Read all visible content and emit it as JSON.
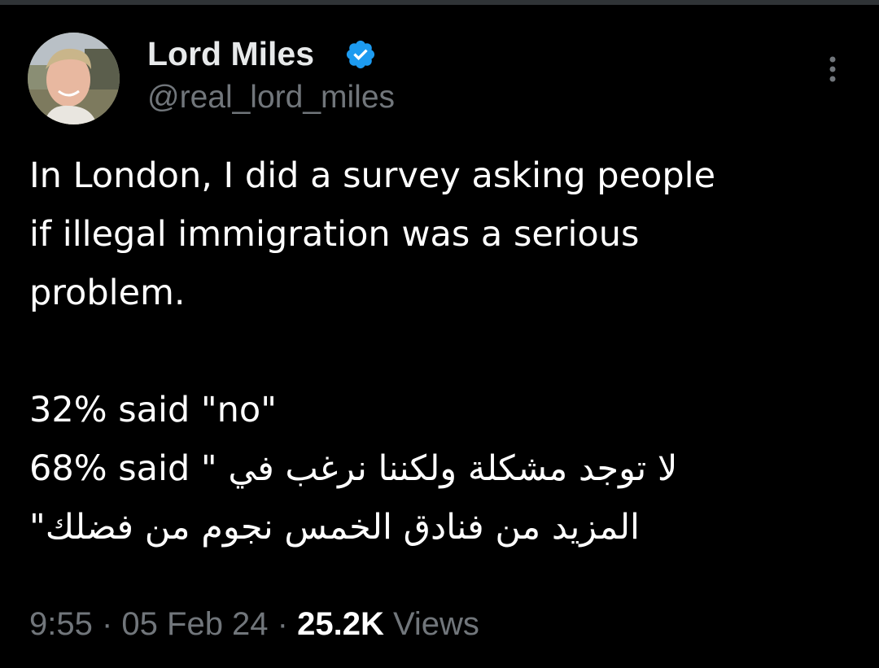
{
  "colors": {
    "background": "#000000",
    "text_primary": "#ffffff",
    "text_secondary": "#71767b",
    "verified_badge": "#1d9bf0",
    "divider": "#2f3336"
  },
  "author": {
    "display_name": "Lord Miles",
    "handle": "@real_lord_miles",
    "avatar_icon": "profile-photo",
    "verified_icon": "verified-badge-icon"
  },
  "header": {
    "more_icon": "more-options-icon"
  },
  "tweet": {
    "line1": "In London, I did a survey asking people",
    "line2": "if illegal immigration was a serious",
    "line3": "problem.",
    "line4": "32% said \"no\"",
    "line5_prefix": "68% said \" ",
    "line5_arabic": "لا توجد مشكلة ولكننا نرغب في",
    "line6_arabic": "المزيد من فنادق الخمس نجوم من فضلك\""
  },
  "meta": {
    "time": "9:55",
    "separator1": " · ",
    "date": "05 Feb 24",
    "separator2": " · ",
    "views_count": "25.2K",
    "views_label": " Views"
  }
}
